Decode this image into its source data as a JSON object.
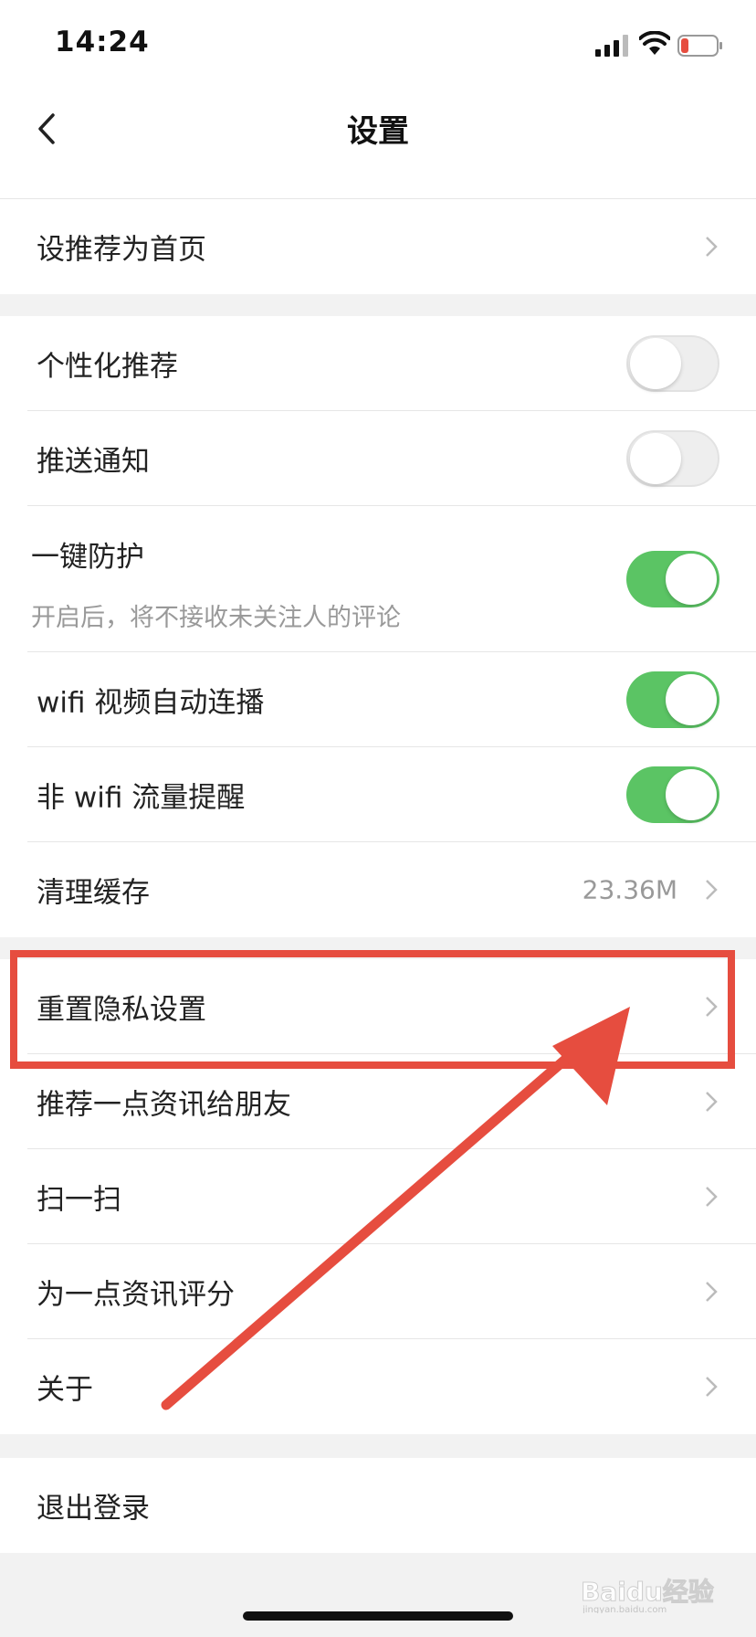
{
  "status_bar": {
    "time": "14:24"
  },
  "nav": {
    "title": "设置"
  },
  "groups": [
    {
      "items": [
        {
          "label": "设推荐为首页",
          "type": "link"
        }
      ]
    },
    {
      "items": [
        {
          "label": "个性化推荐",
          "type": "toggle",
          "on": false
        },
        {
          "label": "推送通知",
          "type": "toggle",
          "on": false
        },
        {
          "label": "一键防护",
          "sub": "开启后，将不接收未关注人的评论",
          "type": "toggle",
          "on": true
        },
        {
          "label": "wifi 视频自动连播",
          "type": "toggle",
          "on": true
        },
        {
          "label": "非 wifi 流量提醒",
          "type": "toggle",
          "on": true
        },
        {
          "label": "清理缓存",
          "value": "23.36M",
          "type": "link"
        }
      ]
    },
    {
      "items": [
        {
          "label": "重置隐私设置",
          "type": "link"
        },
        {
          "label": "推荐一点资讯给朋友",
          "type": "link"
        },
        {
          "label": "扫一扫",
          "type": "link"
        },
        {
          "label": "为一点资讯评分",
          "type": "link"
        },
        {
          "label": "关于",
          "type": "link"
        }
      ]
    },
    {
      "items": [
        {
          "label": "退出登录",
          "type": "action"
        }
      ]
    }
  ],
  "watermark": {
    "text": "Baidu经验",
    "url": "jingyan.baidu.com"
  },
  "colors": {
    "toggle_on": "#5bc464",
    "annotation": "#e64d3f"
  }
}
